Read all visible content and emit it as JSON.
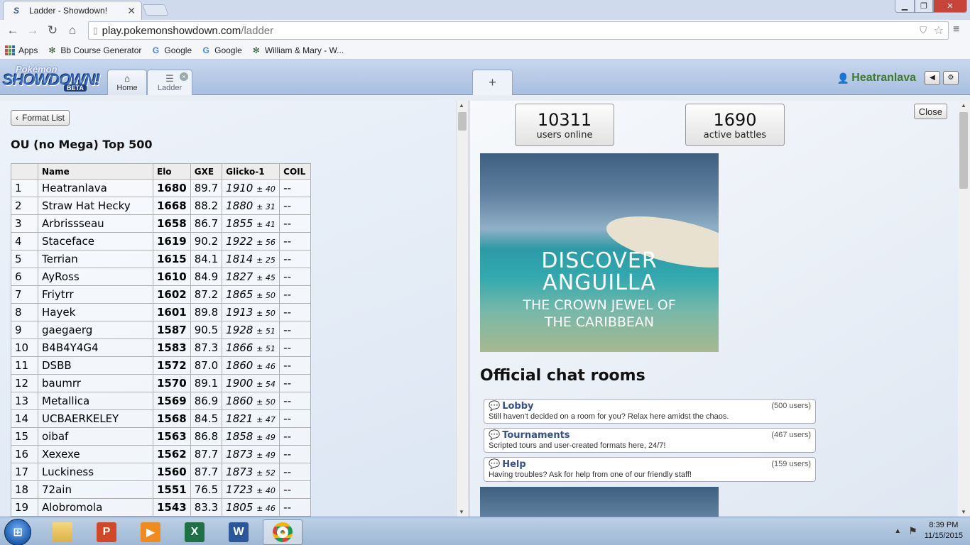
{
  "browser": {
    "tab_title": "Ladder - Showdown!",
    "tab_close": "✕",
    "url_host": "play.pokemonshowdown.com",
    "url_path": "/ladder",
    "bookmarks": [
      {
        "label": "Apps",
        "icon": "apps-grid-icon"
      },
      {
        "label": "Bb Course Generator",
        "icon": "wm-cypher-icon"
      },
      {
        "label": "Google",
        "icon": "google-icon"
      },
      {
        "label": "Google",
        "icon": "google-icon"
      },
      {
        "label": "William & Mary - W...",
        "icon": "wm-cypher-icon"
      }
    ]
  },
  "header": {
    "logo_pokemon": "Pokémon",
    "logo_showdown": "SHOWDOWN!",
    "logo_beta": "BETA",
    "tabs": [
      {
        "label": "Home",
        "icon": "home-icon"
      },
      {
        "label": "Ladder",
        "icon": "list-icon"
      }
    ],
    "plus_tab": "+",
    "username": "Heatranlava"
  },
  "ladder": {
    "format_list_button": "Format List",
    "title": "OU (no Mega) Top 500",
    "columns": [
      "",
      "Name",
      "Elo",
      "GXE",
      "Glicko-1",
      "COIL"
    ],
    "rows": [
      {
        "rank": "1",
        "name": "Heatranlava",
        "elo": "1680",
        "gxe": "89.7",
        "glicko": "1910",
        "dev": "± 40",
        "coil": "--"
      },
      {
        "rank": "2",
        "name": "Straw Hat Hecky",
        "elo": "1668",
        "gxe": "88.2",
        "glicko": "1880",
        "dev": "± 31",
        "coil": "--"
      },
      {
        "rank": "3",
        "name": "Arbrissseau",
        "elo": "1658",
        "gxe": "86.7",
        "glicko": "1855",
        "dev": "± 41",
        "coil": "--"
      },
      {
        "rank": "4",
        "name": "Staceface",
        "elo": "1619",
        "gxe": "90.2",
        "glicko": "1922",
        "dev": "± 56",
        "coil": "--"
      },
      {
        "rank": "5",
        "name": "Terrian",
        "elo": "1615",
        "gxe": "84.1",
        "glicko": "1814",
        "dev": "± 25",
        "coil": "--"
      },
      {
        "rank": "6",
        "name": "AyRoss",
        "elo": "1610",
        "gxe": "84.9",
        "glicko": "1827",
        "dev": "± 45",
        "coil": "--"
      },
      {
        "rank": "7",
        "name": "Friytrr",
        "elo": "1602",
        "gxe": "87.2",
        "glicko": "1865",
        "dev": "± 50",
        "coil": "--"
      },
      {
        "rank": "8",
        "name": "Hayek",
        "elo": "1601",
        "gxe": "89.8",
        "glicko": "1913",
        "dev": "± 50",
        "coil": "--"
      },
      {
        "rank": "9",
        "name": "gaegaerg",
        "elo": "1587",
        "gxe": "90.5",
        "glicko": "1928",
        "dev": "± 51",
        "coil": "--"
      },
      {
        "rank": "10",
        "name": "B4B4Y4G4",
        "elo": "1583",
        "gxe": "87.3",
        "glicko": "1866",
        "dev": "± 51",
        "coil": "--"
      },
      {
        "rank": "11",
        "name": "DSBB",
        "elo": "1572",
        "gxe": "87.0",
        "glicko": "1860",
        "dev": "± 46",
        "coil": "--"
      },
      {
        "rank": "12",
        "name": "baumrr",
        "elo": "1570",
        "gxe": "89.1",
        "glicko": "1900",
        "dev": "± 54",
        "coil": "--"
      },
      {
        "rank": "13",
        "name": "Metallica",
        "elo": "1569",
        "gxe": "86.9",
        "glicko": "1860",
        "dev": "± 50",
        "coil": "--"
      },
      {
        "rank": "14",
        "name": "UCBAERKELEY",
        "elo": "1568",
        "gxe": "84.5",
        "glicko": "1821",
        "dev": "± 47",
        "coil": "--"
      },
      {
        "rank": "15",
        "name": "oibaf",
        "elo": "1563",
        "gxe": "86.8",
        "glicko": "1858",
        "dev": "± 49",
        "coil": "--"
      },
      {
        "rank": "16",
        "name": "Xexexe",
        "elo": "1562",
        "gxe": "87.7",
        "glicko": "1873",
        "dev": "± 49",
        "coil": "--"
      },
      {
        "rank": "17",
        "name": "Luckiness",
        "elo": "1560",
        "gxe": "87.7",
        "glicko": "1873",
        "dev": "± 52",
        "coil": "--"
      },
      {
        "rank": "18",
        "name": "72ain",
        "elo": "1551",
        "gxe": "76.5",
        "glicko": "1723",
        "dev": "± 40",
        "coil": "--"
      },
      {
        "rank": "19",
        "name": "Alobromola",
        "elo": "1543",
        "gxe": "83.3",
        "glicko": "1805",
        "dev": "± 46",
        "coil": "--"
      }
    ]
  },
  "home": {
    "close_button": "Close",
    "users_online": "10311",
    "users_online_label": "users online",
    "active_battles": "1690",
    "active_battles_label": "active battles",
    "ad_line1": "DISCOVER",
    "ad_line2": "ANGUILLA",
    "ad_line3": "THE CROWN JEWEL OF",
    "ad_line4": "THE CARIBBEAN",
    "rooms_title": "Official chat rooms",
    "rooms": [
      {
        "name": "Lobby",
        "count": "(500 users)",
        "desc": "Still haven't decided on a room for you? Relax here amidst the chaos."
      },
      {
        "name": "Tournaments",
        "count": "(467 users)",
        "desc": "Scripted tours and user-created formats here, 24/7!"
      },
      {
        "name": "Help",
        "count": "(159 users)",
        "desc": "Having troubles? Ask for help from one of our friendly staff!"
      }
    ]
  },
  "taskbar": {
    "time": "8:39 PM",
    "date": "11/15/2015",
    "apps": [
      {
        "name": "file-explorer-icon",
        "glyph": "",
        "color": "#d9b24a"
      },
      {
        "name": "powerpoint-icon",
        "glyph": "P",
        "color": "#d24726"
      },
      {
        "name": "media-player-icon",
        "glyph": "▶",
        "color": "#f08c1c"
      },
      {
        "name": "excel-icon",
        "glyph": "X",
        "color": "#1e7145"
      },
      {
        "name": "word-icon",
        "glyph": "W",
        "color": "#2b579a"
      },
      {
        "name": "chrome-icon",
        "glyph": "",
        "color": "#dd4b39"
      }
    ]
  },
  "colors": {
    "username_green": "#3e7a2a",
    "room_link_blue": "#36508a",
    "close_red": "#c8443a"
  }
}
